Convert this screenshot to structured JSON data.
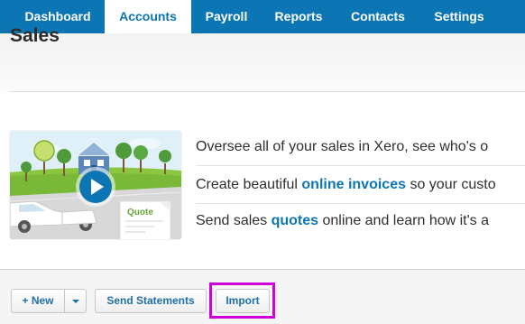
{
  "nav": {
    "tabs": [
      {
        "label": "Dashboard"
      },
      {
        "label": "Accounts"
      },
      {
        "label": "Payroll"
      },
      {
        "label": "Reports"
      },
      {
        "label": "Contacts"
      },
      {
        "label": "Settings"
      }
    ],
    "active": "Accounts"
  },
  "page": {
    "title": "Sales"
  },
  "hero": {
    "quote_card_label": "Quote",
    "lines": [
      {
        "pre": "Oversee all of your sales in Xero, see who's o",
        "link": "",
        "post": ""
      },
      {
        "pre": "Create beautiful ",
        "link": "online invoices",
        "post": " so your custo"
      },
      {
        "pre": "Send sales ",
        "link": "quotes",
        "post": " online and learn how it's a"
      }
    ]
  },
  "toolbar": {
    "new_label": "+ New",
    "send_statements_label": "Send Statements",
    "import_label": "Import"
  },
  "colors": {
    "brand": "#0b76b3",
    "highlight": "#d100d6",
    "button_text": "#1f6fa8"
  },
  "icons": [
    "play-icon",
    "chevron-down-icon"
  ]
}
